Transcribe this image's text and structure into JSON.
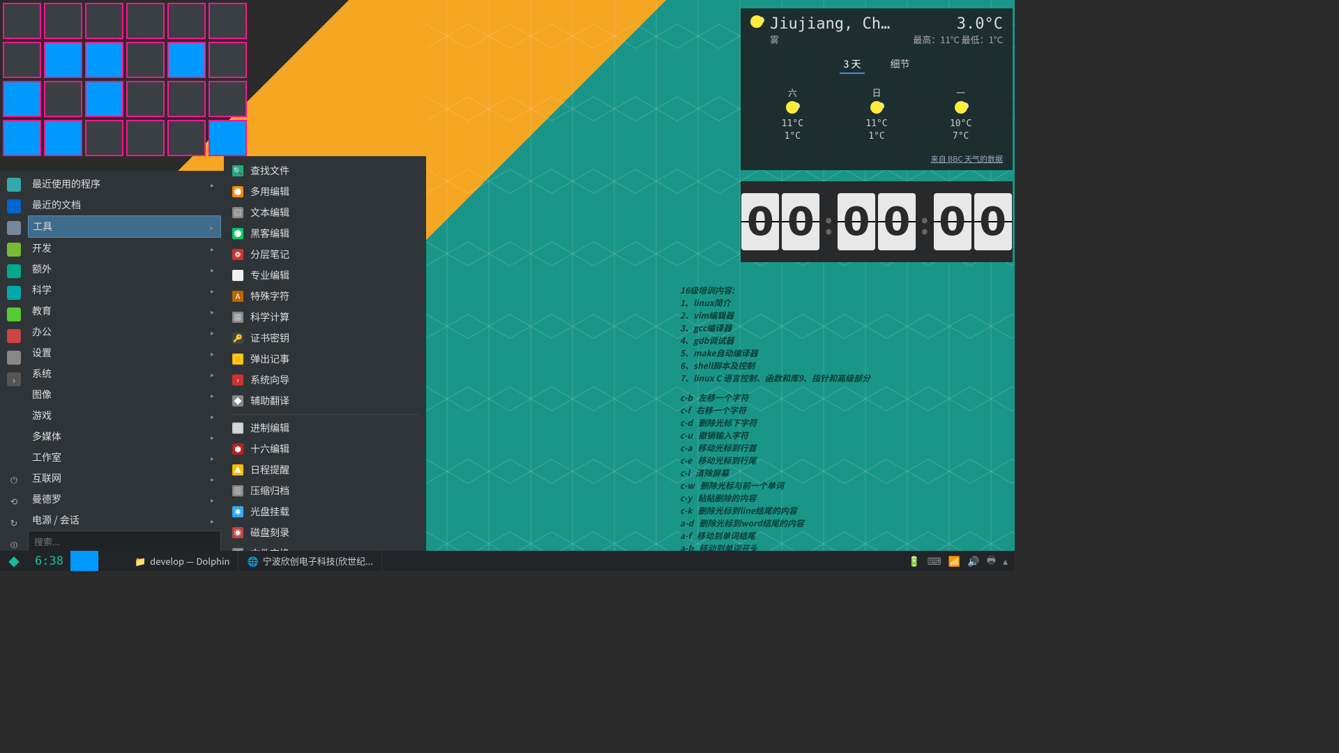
{
  "pager": {
    "active": [
      7,
      8,
      10,
      12,
      14,
      18,
      19,
      23
    ]
  },
  "menu": {
    "header": [
      {
        "label": "最近使用的程序",
        "arrow": true
      },
      {
        "label": "最近的文档",
        "arrow": false
      }
    ],
    "categories": [
      {
        "label": "工具",
        "selected": true
      },
      {
        "label": "开发"
      },
      {
        "label": "额外"
      },
      {
        "label": "科学"
      },
      {
        "label": "教育"
      },
      {
        "label": "办公"
      },
      {
        "label": "设置"
      },
      {
        "label": "系统"
      },
      {
        "label": "图像"
      },
      {
        "label": "游戏"
      },
      {
        "label": "多媒体"
      },
      {
        "label": "工作室"
      },
      {
        "label": "互联网"
      },
      {
        "label": "曼德罗"
      },
      {
        "label": "电源 / 会话"
      }
    ],
    "search_placeholder": "搜索..."
  },
  "submenu": [
    {
      "label": "查找文件",
      "ic": "🔍",
      "bg": "#2a7"
    },
    {
      "label": "多用编辑",
      "ic": "●",
      "bg": "#f80"
    },
    {
      "label": "文本编辑",
      "ic": "▤",
      "bg": "#888"
    },
    {
      "label": "黑客编辑",
      "ic": "●",
      "bg": "#0c6"
    },
    {
      "label": "分层笔记",
      "ic": "❁",
      "bg": "#c33"
    },
    {
      "label": "专业编辑",
      "ic": "▤",
      "bg": "#eee"
    },
    {
      "label": "特殊字符",
      "ic": "A",
      "bg": "#b60"
    },
    {
      "label": "科学计算",
      "ic": "▦",
      "bg": "#888"
    },
    {
      "label": "证书密钥",
      "ic": "🔑",
      "bg": "#444"
    },
    {
      "label": "弹出记事",
      "ic": "▢",
      "bg": "#fb0"
    },
    {
      "label": "系统向导",
      "ic": "›",
      "bg": "#c33"
    },
    {
      "label": "辅助翻译",
      "ic": "◆",
      "bg": "#888"
    },
    {
      "hr": true
    },
    {
      "label": "进制编辑",
      "ic": "▤",
      "bg": "#ccc"
    },
    {
      "label": "十六编辑",
      "ic": "⬢",
      "bg": "#b22"
    },
    {
      "label": "日程提醒",
      "ic": "▲",
      "bg": "#fb0"
    },
    {
      "label": "压缩归档",
      "ic": "▥",
      "bg": "#888"
    },
    {
      "label": "光盘挂载",
      "ic": "✱",
      "bg": "#3ae"
    },
    {
      "label": "磁盘刻录",
      "ic": "◉",
      "bg": "#b44"
    },
    {
      "label": "文件交换",
      "ic": "▤",
      "bg": "#888"
    }
  ],
  "weather": {
    "location": "Jiujiang, Ch…",
    "condition": "雾",
    "current": "3.0°C",
    "hi_lo": "最高：11°C 最低：1°C",
    "tabs": [
      "3 天",
      "细节"
    ],
    "tab_selected": 0,
    "forecast": [
      {
        "day": "六",
        "hi": "11°C",
        "lo": "1°C"
      },
      {
        "day": "日",
        "hi": "11°C",
        "lo": "1°C"
      },
      {
        "day": "一",
        "hi": "10°C",
        "lo": "7°C"
      }
    ],
    "source": "来自 BBC 天气的数据"
  },
  "clock": {
    "digits": [
      "0",
      "0",
      "0",
      "0",
      "0",
      "0"
    ]
  },
  "notes": {
    "title": "16级培训内容:",
    "numbered": [
      "1、linux简介",
      "2、vim编辑器",
      "3、gcc编译器",
      "4、gdb调试器",
      "5、make自动编译器",
      "6、shell脚本及控制",
      "7、linux C 语言控制、函数和库9、指针和高级部分"
    ],
    "shortcuts": [
      [
        "c-b",
        "左移一个字符"
      ],
      [
        "c-f",
        "右移一个字符"
      ],
      [
        "c-d",
        "删除光标下字符"
      ],
      [
        "c-u",
        "撤销输入字符"
      ],
      [
        "c-a",
        "移动光标到行首"
      ],
      [
        "c-e",
        "移动光标到行尾"
      ],
      [
        "c-l",
        "清除屏幕"
      ],
      [
        "c-w",
        "删除光标与前一个单词"
      ],
      [
        "c-y",
        "粘贴删除的内容"
      ],
      [
        "c-k",
        "删除光标到line结尾的内容"
      ],
      [
        "a-d",
        "删除光标到word结尾的内容"
      ],
      [
        "a-f",
        "移动到单词结尾"
      ],
      [
        "a-b",
        "移动到单词开头"
      ]
    ]
  },
  "taskbar": {
    "time": "6:38",
    "tasks": [
      {
        "label": "develop — Dolphin",
        "icon": "📁"
      },
      {
        "label": "宁波欣创电子科技(欣世纪...",
        "icon": "🌐"
      }
    ]
  }
}
